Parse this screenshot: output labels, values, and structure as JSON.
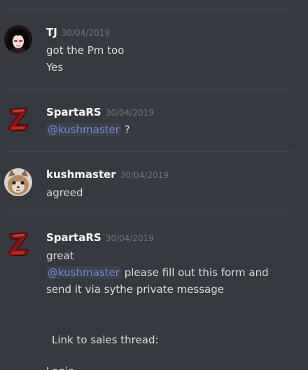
{
  "messages": [
    {
      "username": "TJ",
      "timestamp": "30/04/2019",
      "avatar_icon": "anime-girl-avatar",
      "lines": [
        "got the Pm too",
        "Yes"
      ]
    },
    {
      "username": "SpartaRS",
      "timestamp": "30/04/2019",
      "avatar_icon": "red-z-logo-avatar",
      "mention": "@kushmaster",
      "after_mention": " ?"
    },
    {
      "username": "kushmaster",
      "timestamp": "30/04/2019",
      "avatar_icon": "cat-face-avatar",
      "lines": [
        "agreed"
      ]
    },
    {
      "username": "SpartaRS",
      "timestamp": "30/04/2019",
      "avatar_icon": "red-z-logo-avatar",
      "lines": [
        "great"
      ],
      "mention": "@kushmaster",
      "after_mention": " please fill out this form and send it via sythe private message",
      "form_line": "Link to sales thread:",
      "cut_line": "Login"
    }
  ],
  "colors": {
    "background": "#36393f",
    "username": "#ffffff",
    "timestamp": "#72767d",
    "text": "#dcddde",
    "mention": "#7289da",
    "divider": "#40444b"
  }
}
